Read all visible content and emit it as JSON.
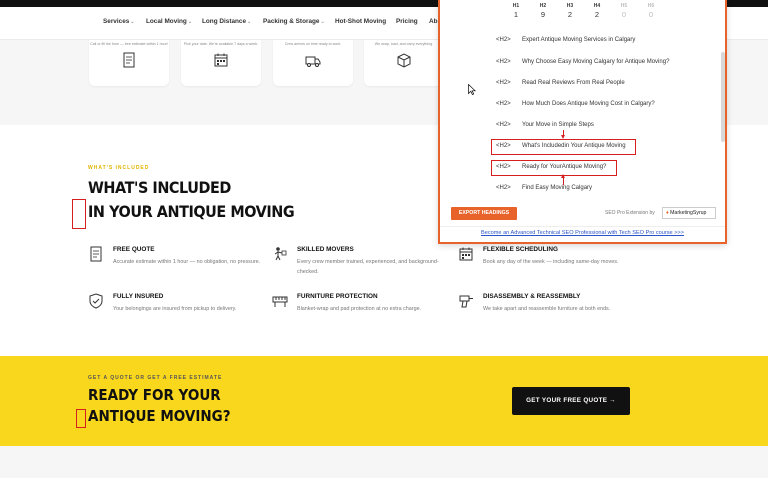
{
  "nav": {
    "items": [
      {
        "label": "Services",
        "chevron": true
      },
      {
        "label": "Local Moving",
        "chevron": true
      },
      {
        "label": "Long Distance",
        "chevron": true
      },
      {
        "label": "Packing & Storage",
        "chevron": true
      },
      {
        "label": "Hot-Shot Moving",
        "chevron": false
      },
      {
        "label": "Pricing",
        "chevron": false
      },
      {
        "label": "Ab",
        "chevron": false
      }
    ]
  },
  "top_cards": [
    {
      "text": "Call or fill the form — free estimate within 1 hour!",
      "icon": "form-icon"
    },
    {
      "text": "Pick your date. We're available 7 days a week.",
      "icon": "calendar-icon"
    },
    {
      "text": "Crew arrives on time ready to work.",
      "icon": "truck-icon"
    },
    {
      "text": "We wrap, load, and carry everything.",
      "icon": "box-icon"
    }
  ],
  "included": {
    "eyebrow": "WHAT'S INCLUDED",
    "headline_line1": "WHAT'S INCLUDED",
    "headline_line2": "IN YOUR ANTIQUE MOVING",
    "features": [
      {
        "title": "FREE QUOTE",
        "desc": "Accurate estimate within 1 hour — no obligation, no pressure.",
        "icon": "document-icon"
      },
      {
        "title": "SKILLED MOVERS",
        "desc": "Every crew member trained, experienced, and background-checked.",
        "icon": "mover-icon"
      },
      {
        "title": "FLEXIBLE SCHEDULING",
        "desc": "Book any day of the week — including same-day moves.",
        "icon": "calendar-icon"
      },
      {
        "title": "FULLY INSURED",
        "desc": "Your belongings are insured from pickup to delivery.",
        "icon": "shield-icon"
      },
      {
        "title": "FURNITURE PROTECTION",
        "desc": "Blanket-wrap and pad protection at no extra charge.",
        "icon": "piano-icon"
      },
      {
        "title": "DISASSEMBLY & REASSEMBLY",
        "desc": "We take apart and reassemble furniture at both ends.",
        "icon": "drill-icon"
      }
    ]
  },
  "cta": {
    "eyebrow": "GET A QUOTE OR GET A FREE ESTIMATE",
    "line1": "READY FOR YOUR",
    "line2": "ANTIQUE MOVING?",
    "button": "GET YOUR FREE QUOTE →"
  },
  "seo_popup": {
    "heading_counts": [
      {
        "level": "H1",
        "count": "1",
        "muted": false
      },
      {
        "level": "H2",
        "count": "9",
        "muted": false
      },
      {
        "level": "H3",
        "count": "2",
        "muted": false
      },
      {
        "level": "H4",
        "count": "2",
        "muted": false
      },
      {
        "level": "H5",
        "count": "0",
        "muted": true
      },
      {
        "level": "H6",
        "count": "0",
        "muted": true
      }
    ],
    "headings": [
      {
        "tag": "<H2>",
        "text": "Expert Antique Moving Services in Calgary"
      },
      {
        "tag": "<H2>",
        "text": "Why Choose Easy Moving Calgary for Antique Moving?"
      },
      {
        "tag": "<H2>",
        "text": "Read Real Reviews From Real People"
      },
      {
        "tag": "<H2>",
        "text": "How Much Does Antique Moving Cost in Calgary?"
      },
      {
        "tag": "<H2>",
        "text": "Your Move in Simple Steps"
      },
      {
        "tag": "<H2>",
        "text": "What's Includedin Your Antique Moving"
      },
      {
        "tag": "<H2>",
        "text": "Ready for YourAntique Moving?"
      },
      {
        "tag": "<H2>",
        "text": "Find Easy Moving Calgary"
      }
    ],
    "export_button": "EXPORT HEADINGS",
    "extension_label": "SEO Pro Extension by",
    "brand": "MarketingSyrup",
    "promo_link": "Become an Advanced Technical SEO Professional with Tech SEO Pro course >>>"
  },
  "colors": {
    "accent": "#f9d71c",
    "popup_border": "#e8632a",
    "annotation": "#d62020"
  }
}
